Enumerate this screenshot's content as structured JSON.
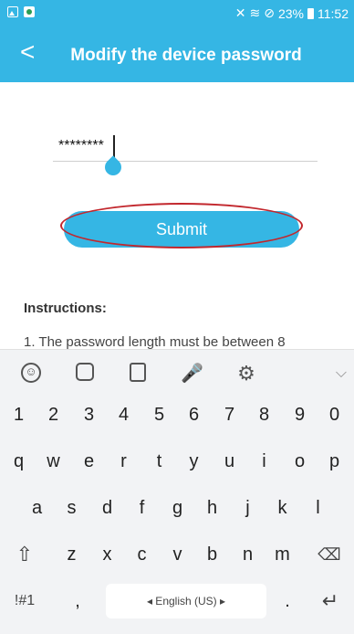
{
  "status_bar": {
    "signal_text": "23%",
    "time": "11:52"
  },
  "app_bar": {
    "back_label": "<",
    "title": "Modify the device password"
  },
  "form": {
    "password_value": "********",
    "submit_label": "Submit"
  },
  "instructions": {
    "title": "Instructions:",
    "line1": "1. The password length must be between 8"
  },
  "keyboard": {
    "row1": [
      "1",
      "2",
      "3",
      "4",
      "5",
      "6",
      "7",
      "8",
      "9",
      "0"
    ],
    "row2": [
      "q",
      "w",
      "e",
      "r",
      "t",
      "y",
      "u",
      "i",
      "o",
      "p"
    ],
    "row3": [
      "a",
      "s",
      "d",
      "f",
      "g",
      "h",
      "j",
      "k",
      "l"
    ],
    "row4": [
      "z",
      "x",
      "c",
      "v",
      "b",
      "n",
      "m"
    ],
    "symbols_label": "!#1",
    "comma_label": ",",
    "space_label": "◂ English (US) ▸",
    "period_label": "."
  },
  "colors": {
    "accent": "#35b6e4",
    "annotation_ring": "#c2272d"
  }
}
